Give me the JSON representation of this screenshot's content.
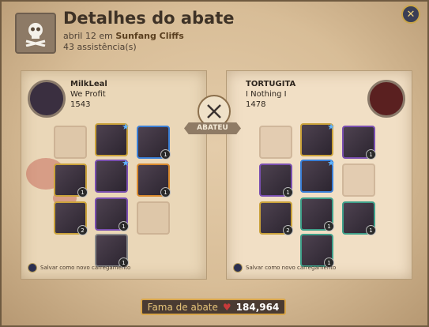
{
  "header": {
    "title": "Detalhes do abate",
    "date_prefix": "abril 12 em",
    "location": "Sunfang Cliffs",
    "assists": "43 assistência(s)",
    "close_label": "✕"
  },
  "killer": {
    "name": "MilkLeal",
    "guild": "We Profit",
    "ip": "1543"
  },
  "victim": {
    "name": "TORTUGITA",
    "guild": "I Nothing I",
    "ip": "1478"
  },
  "center_label": "ABATEU",
  "save_loadout": "Salvar como novo carregamento",
  "fame": {
    "label": "Fama de abate",
    "value": "184,964"
  },
  "colors": {
    "accent": "#d9a64a",
    "fame_bg": "#4a3b32",
    "panel_bg": "#ead7b8"
  }
}
